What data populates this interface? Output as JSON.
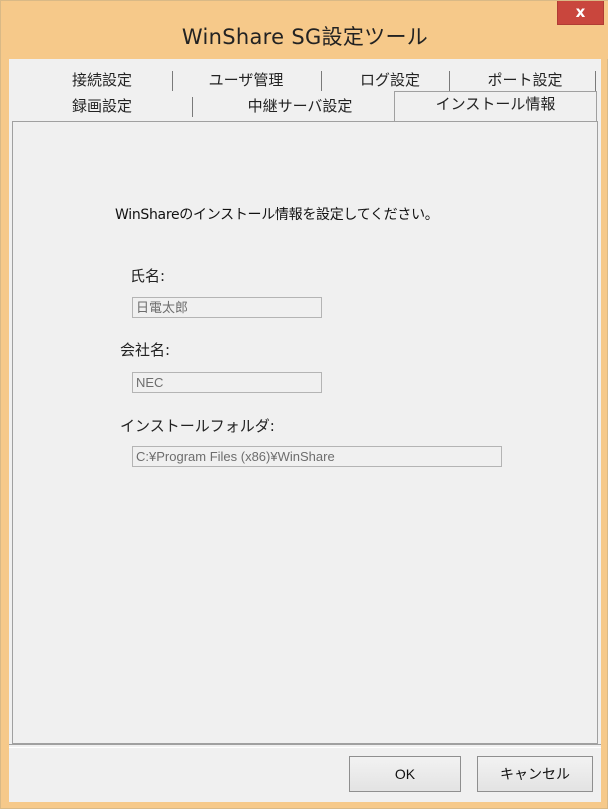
{
  "window": {
    "title": "WinShare SG設定ツール",
    "close_label": "x"
  },
  "tabs": {
    "row1": [
      "接続設定",
      "ユーザ管理",
      "ログ設定",
      "ポート設定"
    ],
    "row2": [
      "録画設定",
      "中継サーバ設定",
      "インストール情報"
    ],
    "selected": "インストール情報"
  },
  "panel": {
    "description": "WinShareのインストール情報を設定してください。",
    "name_label": "氏名:",
    "name_value": "日電太郎",
    "company_label": "会社名:",
    "company_value": "NEC",
    "folder_label": "インストールフォルダ:",
    "folder_value": "C:¥Program Files (x86)¥WinShare"
  },
  "buttons": {
    "ok": "OK",
    "cancel": "キャンセル"
  }
}
